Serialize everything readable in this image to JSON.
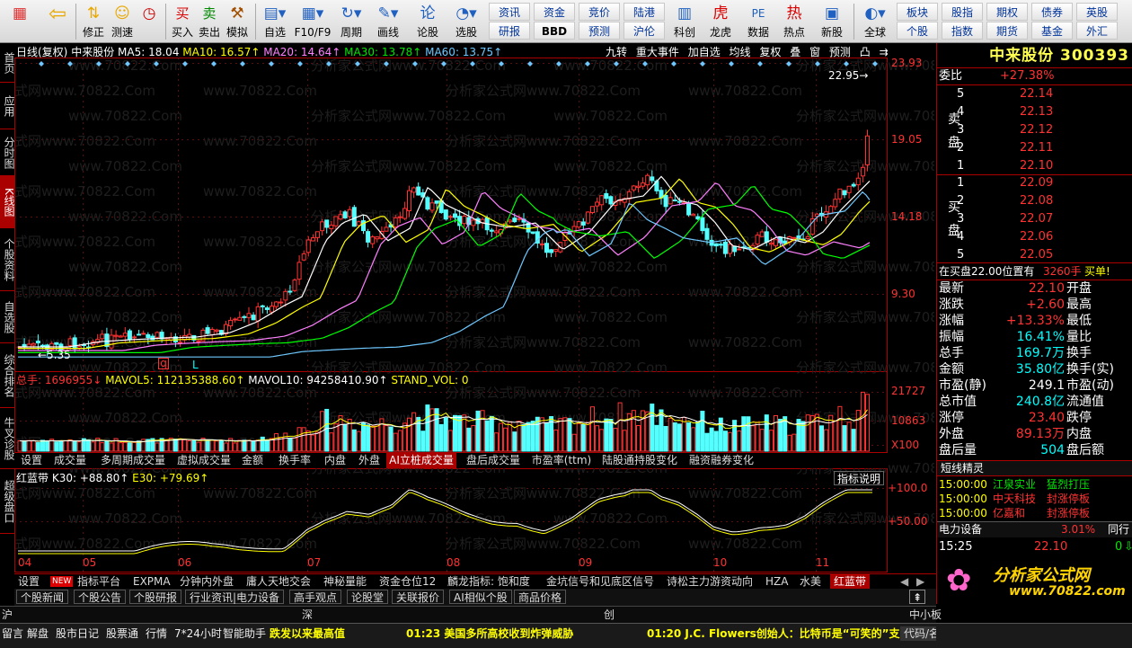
{
  "toolbar": {
    "items": [
      {
        "label": "",
        "icon": "■"
      },
      {
        "label": "",
        "icon": "⇦"
      },
      {
        "label": "修正",
        "icon": "⇅"
      },
      {
        "label": "测速",
        "icon": "☺"
      },
      {
        "label": "",
        "icon": "⌚"
      },
      {
        "label": "买入",
        "icon": "买"
      },
      {
        "label": "卖出",
        "icon": "卖"
      },
      {
        "label": "模拟",
        "icon": "⚒"
      },
      {
        "label": "自选",
        "icon": "▤"
      },
      {
        "label": "F10/F9",
        "icon": "▦"
      },
      {
        "label": "周期",
        "icon": "↻"
      },
      {
        "label": "画线",
        "icon": "✎"
      },
      {
        "label": "论股",
        "icon": "论"
      },
      {
        "label": "选股",
        "icon": "◔"
      }
    ],
    "quick": [
      "资讯",
      "资金",
      "竞价",
      "陆港",
      "研报",
      "BBD",
      "预测",
      "沪伦"
    ],
    "icons2": [
      {
        "label": "科创",
        "icon": "▥"
      },
      {
        "label": "龙虎",
        "icon": "虎"
      },
      {
        "label": "数据",
        "icon": "PE"
      },
      {
        "label": "热点",
        "icon": "热"
      },
      {
        "label": "新股",
        "icon": "▣"
      },
      {
        "label": "全球",
        "icon": "◐"
      }
    ],
    "right": [
      "板块",
      "股指",
      "期权",
      "债券",
      "英股",
      "个股",
      "指数",
      "期货",
      "基金",
      "外汇"
    ]
  },
  "lefttabs": [
    "首页",
    "应用",
    "分时图",
    "K线图",
    "个股资料",
    "自选股",
    "综合排名",
    "牛叉诊股",
    "超级盘口"
  ],
  "chart": {
    "header": {
      "period": "日线(复权)",
      "name": "中来股份",
      "ma5": "MA5: 18.04",
      "ma10": "MA10: 16.57↑",
      "ma20": "MA20: 14.64↑",
      "ma30": "MA30: 13.78↑",
      "ma60": "MA60: 13.75↑"
    },
    "top_buttons": [
      "九转",
      "重大事件",
      "加自选",
      "均线",
      "复权",
      "叠",
      "窗",
      "预测",
      "凸",
      "⇉"
    ],
    "price_ticks": [
      "23.93",
      "19.05",
      "14.18",
      "9.30"
    ],
    "high_label": "22.95→",
    "low_label": "←5.35",
    "flag_q": "q",
    "flag_l": "L",
    "vol_header": {
      "a": "总手: 1696955↓",
      "b": "MAVOL5: 112135388.60↑",
      "c": "MAVOL10: 94258410.90↑",
      "d": "STAND_VOL: 0"
    },
    "vol_ticks": [
      "21727",
      "10863",
      "X100"
    ],
    "vol_tabs": [
      "设置",
      "成交量",
      "多周期成交量",
      "虚拟成交量",
      "金额",
      "换手率",
      "内盘",
      "外盘",
      "AI立桩成交量",
      "盘后成交量",
      "市盈率(ttm)",
      "陆股通持股变化",
      "融资融券变化"
    ],
    "ind_header": {
      "a": "红蓝带",
      "b": "K30: +88.80↑",
      "c": "E30: +79.69↑"
    },
    "ind_button": "指标说明",
    "ind_ticks": [
      "+100.0",
      "+50.00"
    ],
    "x_labels": [
      "04",
      "05",
      "06",
      "07",
      "08",
      "09",
      "10",
      "11"
    ],
    "watermarks": [
      "www.70822.Com",
      "分析家公式网www.70822.Com"
    ]
  },
  "bottom_tabs1": [
    "设置",
    "NEW",
    "指标平台",
    "EXPMA",
    "分钟内外盘",
    "庸人天地交会",
    "神秘量能",
    "资金仓位12",
    "麟龙指标: 饱和度",
    "金坑信号和见底区信号",
    "诗松主力游资动向",
    "HZA",
    "水美",
    "红蓝带"
  ],
  "bottom_tabs2": [
    "个股新闻",
    "个股公告",
    "个股研报",
    "行业资讯|电力设备",
    "高手观点",
    "论股堂",
    "关联报价",
    "AI相似个股",
    "商品价格"
  ],
  "index_bar": [
    "沪",
    "深",
    "创",
    "中小板"
  ],
  "status": [
    "留言",
    "解盘",
    "股市日记",
    "股票通",
    "行情",
    "7*24小时",
    "智能助手"
  ],
  "ticker": [
    {
      "t": "跌发以来最高值",
      "c": "yellow"
    },
    {
      "t": "01:23 美国多所高校收到炸弹威胁",
      "c": "yellow"
    },
    {
      "t": "01:20 J.C. Flowers创始人：比特币是“可笑的”支",
      "c": "yellow"
    }
  ],
  "code_label": "代码/名称",
  "right": {
    "title": "中来股份 300393",
    "weibi": "委比",
    "weibi_val": "+27.38%",
    "sell_label": "卖盘",
    "buy_label": "买盘",
    "sell": [
      {
        "n": "5",
        "p": "22.14"
      },
      {
        "n": "4",
        "p": "22.13"
      },
      {
        "n": "3",
        "p": "22.12"
      },
      {
        "n": "2",
        "p": "22.11"
      },
      {
        "n": "1",
        "p": "22.10"
      }
    ],
    "buy": [
      {
        "n": "1",
        "p": "22.09"
      },
      {
        "n": "2",
        "p": "22.08"
      },
      {
        "n": "3",
        "p": "22.07"
      },
      {
        "n": "4",
        "p": "22.06"
      },
      {
        "n": "5",
        "p": "22.05"
      }
    ],
    "note": "在买盘22.00位置有",
    "note_v": "3260手",
    "note_b": "买单!",
    "stats": [
      {
        "l": "最新",
        "v": "22.10",
        "c": "red",
        "l2": "开盘"
      },
      {
        "l": "涨跌",
        "v": "+2.60",
        "c": "red",
        "l2": "最高"
      },
      {
        "l": "涨幅",
        "v": "+13.33%",
        "c": "red",
        "l2": "最低"
      },
      {
        "l": "振幅",
        "v": "16.41%",
        "c": "cyan",
        "l2": "量比"
      },
      {
        "l": "总手",
        "v": "169.7万",
        "c": "cyan",
        "l2": "换手"
      },
      {
        "l": "金额",
        "v": "35.80亿",
        "c": "cyan",
        "l2": "换手(实)"
      },
      {
        "l": "市盈(静)",
        "v": "249.1",
        "c": "white",
        "l2": "市盈(动)"
      },
      {
        "l": "总市值",
        "v": "240.8亿",
        "c": "cyan",
        "l2": "流通值"
      },
      {
        "l": "涨停",
        "v": "23.40",
        "c": "red",
        "l2": "跌停"
      },
      {
        "l": "外盘",
        "v": "89.13万",
        "c": "red",
        "l2": "内盘"
      },
      {
        "l": "盘后量",
        "v": "504",
        "c": "cyan",
        "l2": "盘后额"
      }
    ],
    "sprite": "短线精灵",
    "sprite_rows": [
      {
        "t": "15:00:00",
        "s": "江泉实业",
        "e": "猛烈打压",
        "c": "green"
      },
      {
        "t": "15:00:00",
        "s": "中天科技",
        "e": "封涨停板",
        "c": "red"
      },
      {
        "t": "15:00:00",
        "s": "亿嘉和",
        "e": "封涨停板",
        "c": "red"
      }
    ],
    "sector": "电力设备",
    "sector_pct": "3.01%",
    "sector_extra": "同行",
    "last_time": "15:25",
    "last_price": "22.10",
    "last_vol": "0",
    "logo": "分析家公式网",
    "logo_url": "www.70822.com"
  },
  "colors": {
    "up": "#ff3232",
    "down": "#54ffff",
    "ma5": "#ffffff",
    "ma10": "#ffff00",
    "ma20": "#ff80ff",
    "ma30": "#00ff00",
    "ma60": "#6ec8ff"
  }
}
